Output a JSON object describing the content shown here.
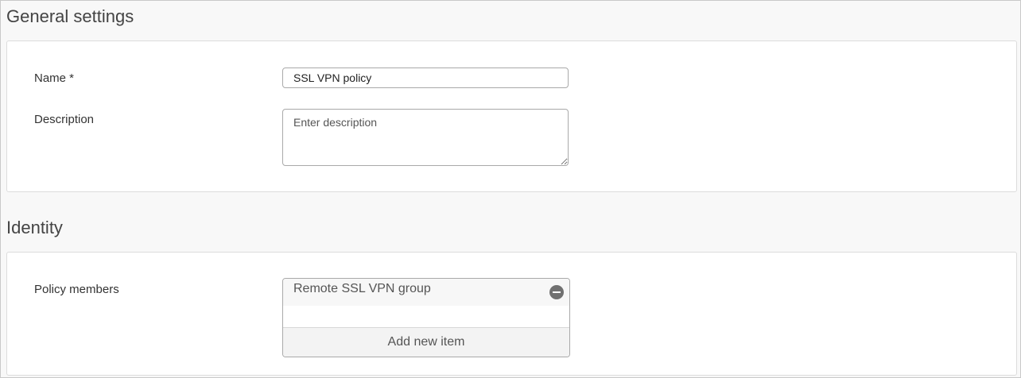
{
  "general": {
    "title": "General settings",
    "name_label": "Name *",
    "name_value": "SSL VPN policy",
    "description_label": "Description",
    "description_placeholder": "Enter description",
    "description_value": ""
  },
  "identity": {
    "title": "Identity",
    "members_label": "Policy members",
    "members": [
      {
        "label": "Remote SSL VPN group",
        "remove_icon": "remove-circle-icon"
      }
    ],
    "add_item_label": "Add new item"
  }
}
